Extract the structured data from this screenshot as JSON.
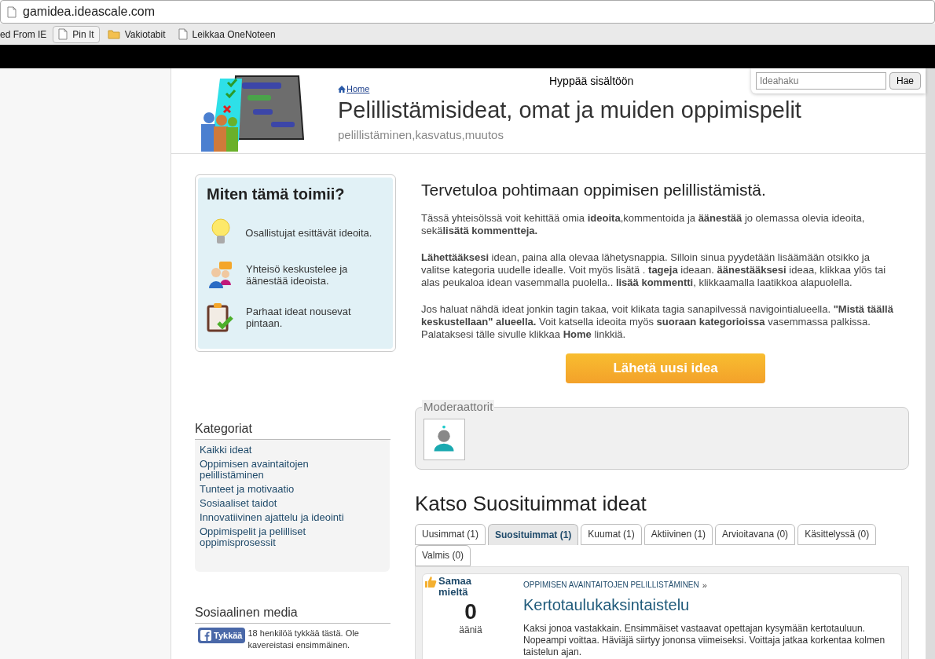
{
  "browser": {
    "url": "gamidea.ideascale.com",
    "bookmarks": [
      {
        "label": "ed From IE",
        "kind": "none"
      },
      {
        "label": "Pin It",
        "kind": "doc-button"
      },
      {
        "label": "Vakiotabit",
        "kind": "folder"
      },
      {
        "label": "Leikkaa OneNoteen",
        "kind": "doc"
      }
    ]
  },
  "header": {
    "skip_link": "Hyppää sisältöön",
    "search": {
      "placeholder": "Ideahaku"
    },
    "search_button": "Hae",
    "breadcrumb": "Home",
    "title": "Pelillistämisideat, omat ja muiden oppimispelit",
    "tags": "pelillistäminen,kasvatus,muutos"
  },
  "how_it_works": {
    "title": "Miten tämä toimii?",
    "steps": [
      {
        "text": "Osallistujat esittävät ideoita.",
        "kind": "bulb"
      },
      {
        "text": "Yhteisö keskustelee ja äänestää ideoista.",
        "kind": "people"
      },
      {
        "text": "Parhaat ideat nousevat pintaan.",
        "kind": "clipboard"
      }
    ]
  },
  "categories": {
    "heading": "Kategoriat",
    "items": [
      "Kaikki ideat",
      "Oppimisen avaintaitojen pelillistäminen",
      "Tunteet ja motivaatio",
      "Sosiaaliset taidot",
      "Innovatiivinen ajattelu ja ideointi",
      "Oppimispelit ja pelilliset oppimisprosessit"
    ]
  },
  "social": {
    "heading": "Sosiaalinen media",
    "like_button": "Tykkää",
    "like_text": "18 henkilöä tykkää tästä. Ole kavereistasi ensimmäinen."
  },
  "welcome": {
    "title": "Tervetuloa pohtimaan oppimisen pelillistämistä.",
    "paragraphs": [
      "Tässä yhteisölssä voit kehittää omia **ideoita**,kommentoida ja **äänestää** jo olemassa olevia ideoita, sekä**lisätä kommentteja.**",
      "**Lähettääksesi** idean, paina alla olevaa lähetysnappia. Silloin sinua pyydetään lisäämään otsikko ja valitse kategoria uudelle idealle. Voit myös lisätä . **tageja** ideaan. **äänestääksesi** ideaa, klikkaa ylös tai alas peukaloa idean vasemmalla puolella.. **lisää kommentti**, klikkaamalla laatikkoa alapuolella.",
      "Jos haluat nähdä ideat jonkin tagin takaa, voit klikata tagia sanapilvessä navigointialueella. **\"Mistä täällä keskustellaan\" alueella.** Voit katsella ideoita myös **suoraan kategorioissa** vasemmassa palkissa. Palataksesi tälle sivulle klikkaa **Home** linkkiä."
    ],
    "submit_button": "Lähetä uusi idea"
  },
  "moderators": {
    "legend": "Moderaattorit"
  },
  "ideas": {
    "heading": "Katso Suosituimmat ideat",
    "tabs": [
      {
        "label": "Uusimmat (1)",
        "selected": false
      },
      {
        "label": "Suosituimmat (1)",
        "selected": true
      },
      {
        "label": "Kuumat (1)",
        "selected": false
      },
      {
        "label": "Aktiivinen (1)",
        "selected": false
      },
      {
        "label": "Arvioitavana (0)",
        "selected": false
      },
      {
        "label": "Käsittelyssä (0)",
        "selected": false
      },
      {
        "label": "Valmis (0)",
        "selected": false
      }
    ],
    "idea": {
      "vote_label": "Samaa mieltä",
      "votes": "0",
      "votes_unit": "ääniä",
      "category": "OPPIMISEN AVAINTAITOJEN PELILLISTÄMINEN",
      "category_arrow": "»",
      "title": "Kertotaulukaksintaistelu",
      "description": "Kaksi jonoa vastakkain. Ensimmäiset vastaavat opettajan kysymään kertotauluun. Nopeampi voittaa. Häviäjä siirtyy jononsa viimeiseksi. Voittaja jatkaa korkentaa kolmen taistelun ajan."
    }
  }
}
